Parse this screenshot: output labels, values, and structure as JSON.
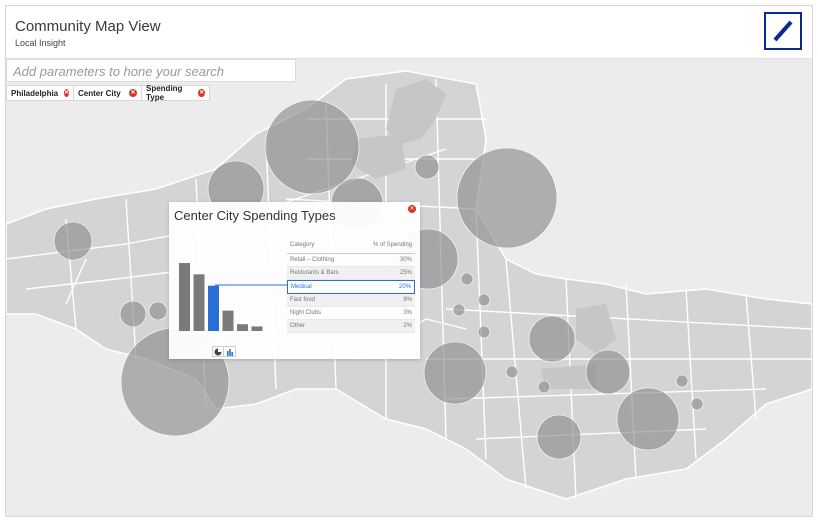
{
  "header": {
    "title": "Community Map View",
    "subtitle": "Local Insight"
  },
  "search": {
    "placeholder": "Add parameters to hone your search"
  },
  "filters": [
    {
      "label": "Philadelphia"
    },
    {
      "label": "Center City"
    },
    {
      "label": "Spending Type"
    }
  ],
  "popup": {
    "title": "Center City Spending Types",
    "table": {
      "col_category": "Category",
      "col_percent": "% of Spending",
      "rows": [
        {
          "category": "Retail – Clothing",
          "percent": "30%"
        },
        {
          "category": "Resturants & Bars",
          "percent": "25%"
        },
        {
          "category": "Medical",
          "percent": "20%"
        },
        {
          "category": "Fast food",
          "percent": "9%"
        },
        {
          "category": "Night Clubs",
          "percent": "3%"
        },
        {
          "category": "Other",
          "percent": "2%"
        }
      ]
    },
    "selected_category": "Medical",
    "bar_values": [
      30,
      25,
      20,
      9,
      3,
      2
    ]
  },
  "colors": {
    "accent_blue": "#2b6fd6",
    "remove_red": "#d9342b",
    "logo_blue": "#0a2a8f"
  },
  "icons": {
    "pie_toggle": "pie-chart-icon",
    "bar_toggle": "bar-chart-icon"
  }
}
